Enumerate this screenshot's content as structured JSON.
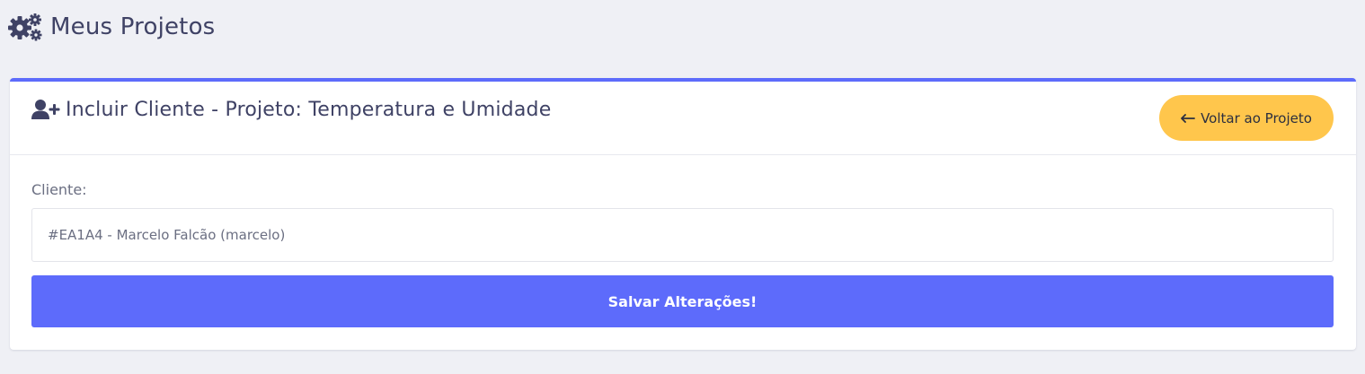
{
  "page": {
    "title": "Meus Projetos",
    "icon": "gears-icon"
  },
  "card": {
    "title": "Incluir Cliente - Projeto: Temperatura e Umidade",
    "icon": "user-plus-icon",
    "back_button": {
      "label": "Voltar ao Projeto",
      "icon": "arrow-left-icon"
    }
  },
  "form": {
    "client_label": "Cliente:",
    "client_value": "#EA1A4 - Marcelo Falcão (marcelo)",
    "save_label": "Salvar Alterações!"
  },
  "colors": {
    "background": "#eff0f5",
    "accent": "#5d6bfb",
    "warning": "#ffc64c",
    "text": "#3f4265"
  }
}
